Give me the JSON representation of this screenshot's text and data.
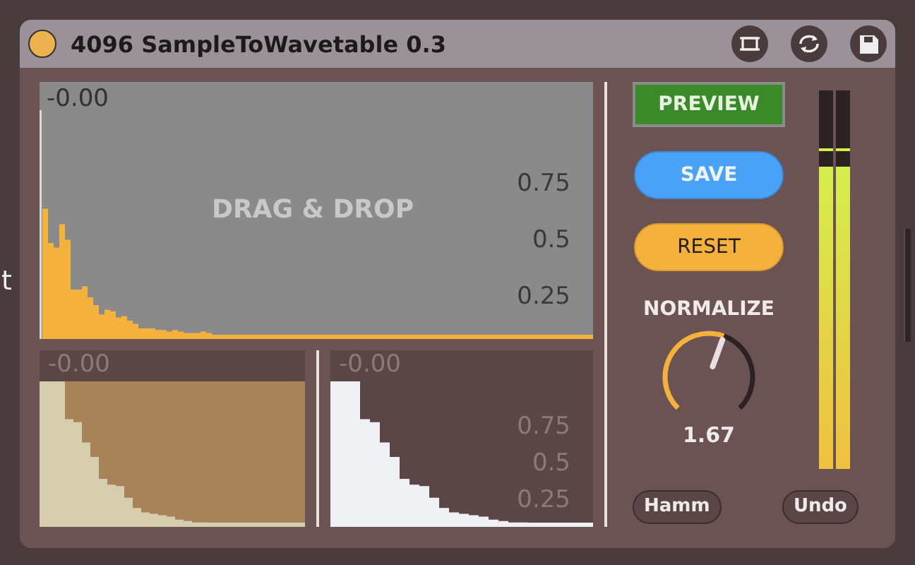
{
  "left_edge_text": "t",
  "device": {
    "title": "4096 SampleToWavetable 0.3"
  },
  "main_graph": {
    "top_label": "-0.00",
    "overlay": "DRAG & DROP",
    "ticks": [
      "0.75",
      "0.5",
      "0.25"
    ]
  },
  "small_graphs": [
    {
      "kind": "filled",
      "top_label": "-0.00"
    },
    {
      "kind": "dark",
      "top_label": "-0.00",
      "ticks": [
        "0.75",
        "0.5",
        "0.25"
      ]
    }
  ],
  "buttons": [
    {
      "kind": "preview",
      "label": "PREVIEW"
    },
    {
      "kind": "save",
      "label": "SAVE"
    },
    {
      "kind": "reset",
      "label": "RESET"
    }
  ],
  "knob": {
    "label": "NORMALIZE",
    "reading": "1.67"
  },
  "meters": [
    {
      "level": 0.8
    },
    {
      "level": 0.8
    }
  ],
  "footer_buttons": [
    "Hamm",
    "Undo"
  ]
}
